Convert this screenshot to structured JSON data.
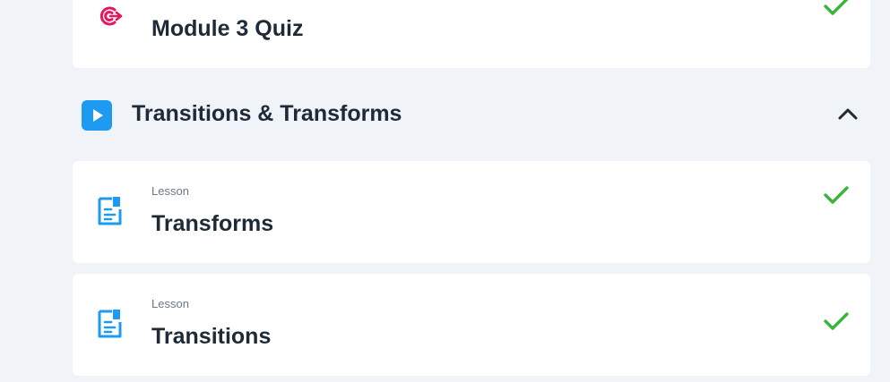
{
  "previous_item": {
    "kind": "Quiz",
    "title": "Module 3 Quiz",
    "icon": "target-quiz-icon",
    "completed": true
  },
  "section": {
    "title": "Transitions & Transforms",
    "icon": "play-icon",
    "expanded": true,
    "items": [
      {
        "kind": "Lesson",
        "title": "Transforms",
        "icon": "lesson-doc-icon",
        "completed": true
      },
      {
        "kind": "Lesson",
        "title": "Transitions",
        "icon": "lesson-doc-icon",
        "completed": true
      }
    ]
  },
  "colors": {
    "background": "#f0f3f7",
    "card": "#ffffff",
    "title_text": "#1f2a37",
    "muted_text": "#6b7785",
    "quiz_icon": "#e8175d",
    "lesson_icon": "#1e9bf0",
    "section_icon_bg": "#1e9bf0",
    "check": "#3ab53a"
  }
}
